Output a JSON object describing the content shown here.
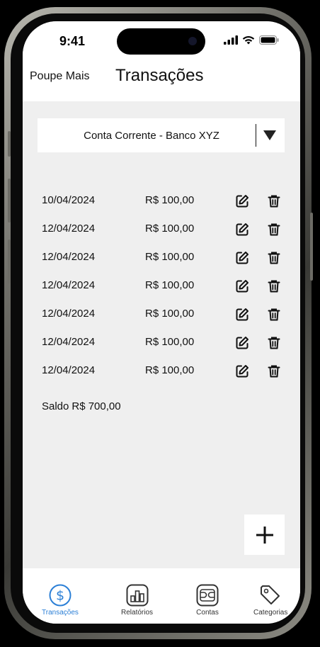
{
  "status_bar": {
    "time": "9:41"
  },
  "header": {
    "app_name": "Poupe Mais",
    "title": "Transações"
  },
  "account": {
    "selected": "Conta Corrente - Banco XYZ"
  },
  "transactions": [
    {
      "date": "10/04/2024",
      "amount": "R$ 100,00"
    },
    {
      "date": "12/04/2024",
      "amount": "R$ 100,00"
    },
    {
      "date": "12/04/2024",
      "amount": "R$ 100,00"
    },
    {
      "date": "12/04/2024",
      "amount": "R$ 100,00"
    },
    {
      "date": "12/04/2024",
      "amount": "R$ 100,00"
    },
    {
      "date": "12/04/2024",
      "amount": "R$ 100,00"
    },
    {
      "date": "12/04/2024",
      "amount": "R$ 100,00"
    }
  ],
  "balance": {
    "label": "Saldo",
    "value": "R$ 700,00"
  },
  "fab": {
    "icon": "plus-icon"
  },
  "tabs": [
    {
      "label": "Transações",
      "icon": "dollar-icon",
      "active": true
    },
    {
      "label": "Relatórios",
      "icon": "bar-chart-icon",
      "active": false
    },
    {
      "label": "Contas",
      "icon": "wallet-icon",
      "active": false
    },
    {
      "label": "Categorias",
      "icon": "tag-icon",
      "active": false
    }
  ],
  "colors": {
    "accent": "#2b7fd6",
    "background": "#efefef",
    "surface": "#ffffff",
    "text": "#111111"
  }
}
